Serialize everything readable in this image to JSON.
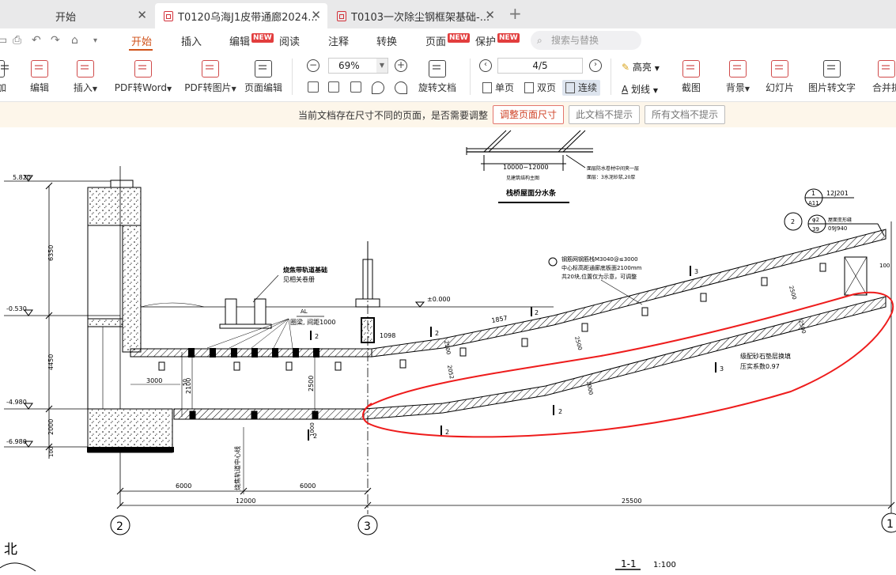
{
  "tabs": [
    {
      "label": "开始",
      "active": false
    },
    {
      "label": "T0120乌海J1皮带通廊2024...",
      "active": true
    },
    {
      "label": "T0103一次除尘钢框架基础-...",
      "active": false
    }
  ],
  "new_tab_label": "+",
  "menu": {
    "items": [
      "开始",
      "插入",
      "编辑",
      "阅读",
      "注释",
      "转换",
      "页面",
      "保护"
    ],
    "new_badge": "NEW",
    "search_placeholder": "搜索与替换"
  },
  "toolbar": {
    "left_cut": "加",
    "edit": "编辑",
    "insert": "插入",
    "pdf_to_word": "PDF转Word",
    "pdf_to_image": "PDF转图片",
    "page_edit": "页面编辑",
    "zoom": "69%",
    "rotate_doc": "旋转文档",
    "page_indicator": "4/5",
    "single_page": "单页",
    "double_page": "双页",
    "continuous": "连续",
    "highlight": "高亮",
    "underline": "划线",
    "screenshot": "截图",
    "background": "背景",
    "slideshow": "幻灯片",
    "image_to_text": "图片转文字",
    "merge_split": "合并拆"
  },
  "notify": {
    "message": "当前文档存在尺寸不同的页面，是否需要调整",
    "adjust": "调整页面尺寸",
    "skip_this": "此文档不提示",
    "skip_all": "所有文档不提示"
  },
  "drawing": {
    "elevations": [
      "5.820",
      "-0.530",
      "-4.980",
      "-6.980"
    ],
    "level_zero": "±0.000",
    "vertical_dims": [
      "6350",
      "4450",
      "2000",
      "100"
    ],
    "top_dim": "10000~12000",
    "top_dim_sub": "见建筑结构主图",
    "top_note_1": "面层防水卷材中间夹一层",
    "top_note_2": "面层：3水泥砂浆,20厚",
    "bridge_title": "栈桥屋面分水条",
    "ref_1_num": "1",
    "ref_1_sheet": "A11",
    "ref_1_code": "12J201",
    "ref_2_num": "2",
    "ref_2_sheet": "39",
    "ref_2_mid": "φ2",
    "ref_2_code": "09J940",
    "ref_2_text": "屋面变形缝",
    "note_track_1": "烧焦带轨道基础",
    "note_track_2": "见相关卷册",
    "note_al": "AL",
    "note_beam": "圈梁, 间距1000",
    "note_steel_1": "钢筋网钢筋栈M3040@≤3000",
    "note_steel_2": "中心标高距通廊底板面2100mm",
    "note_steel_3": "共20块,位置仅为示意，可调整",
    "note_fill_1": "级配砂石垫层换填",
    "note_fill_2": "压实系数0.97",
    "dims_slope": [
      "1098",
      "1857",
      "2500",
      "2500",
      "2500",
      "2500",
      "1000",
      "100",
      "2052"
    ],
    "dims_left": [
      "3000",
      "2100",
      "2500",
      "50",
      "1000"
    ],
    "center_line_label": "烧焦轨道中心线",
    "bottom_dims": [
      "6000",
      "6000",
      "12000",
      "25500"
    ],
    "axis_labels": [
      "2",
      "3",
      "1"
    ],
    "section_label": "1-1",
    "scale": "1:100",
    "north_label": "北",
    "section_marks": [
      "2",
      "2",
      "2",
      "2",
      "2",
      "2",
      "3",
      "3"
    ]
  }
}
